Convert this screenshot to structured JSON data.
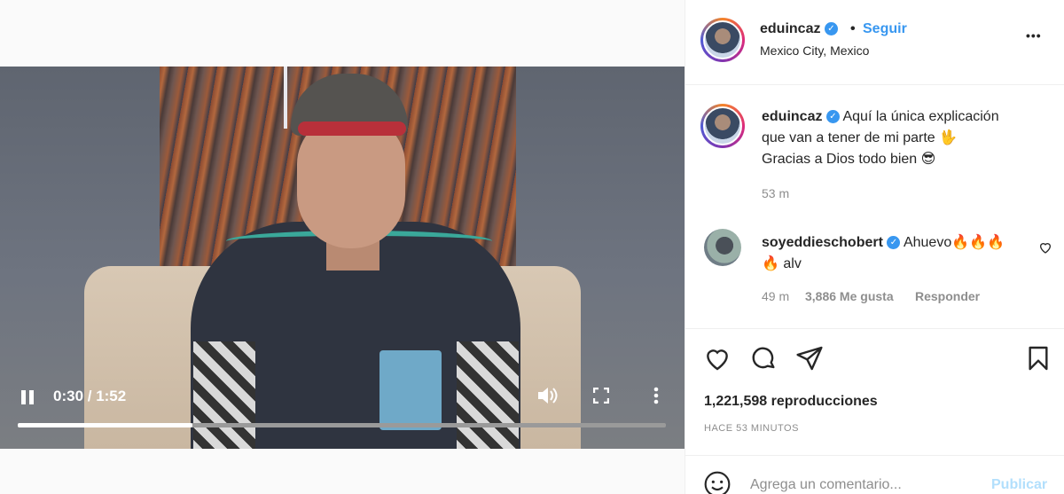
{
  "video": {
    "time_label": "0:30 / 1:52",
    "progress": 0.27
  },
  "post": {
    "username": "eduincaz",
    "follow_label": "Seguir",
    "separator": "•",
    "location": "Mexico City, Mexico",
    "more_label": "•••",
    "caption_lines": [
      "Aquí la única explicación",
      "que van a tener de mi parte 🖖",
      "Gracias a Dios todo bien 😎"
    ],
    "caption_time": "53 m",
    "views": "1,221,598 reproducciones",
    "posted_ago": "HACE 53 MINUTOS"
  },
  "comment": {
    "username": "soyeddieschobert",
    "text_line1": "Ahuevo🔥🔥🔥",
    "text_line2": "🔥 alv",
    "time": "49 m",
    "likes": "3,886 Me gusta",
    "reply_label": "Responder"
  },
  "composer": {
    "placeholder": "Agrega un comentario...",
    "publish_label": "Publicar"
  },
  "icons": {
    "verified": "verified-badge-icon",
    "like": "heart-icon",
    "comment": "comment-bubble-icon",
    "share": "paper-plane-icon",
    "save": "bookmark-icon",
    "emoji": "emoji-icon"
  },
  "colors": {
    "link_blue": "#3897f0",
    "publish_disabled": "#b2dffc",
    "muted": "#8e8e8e"
  }
}
